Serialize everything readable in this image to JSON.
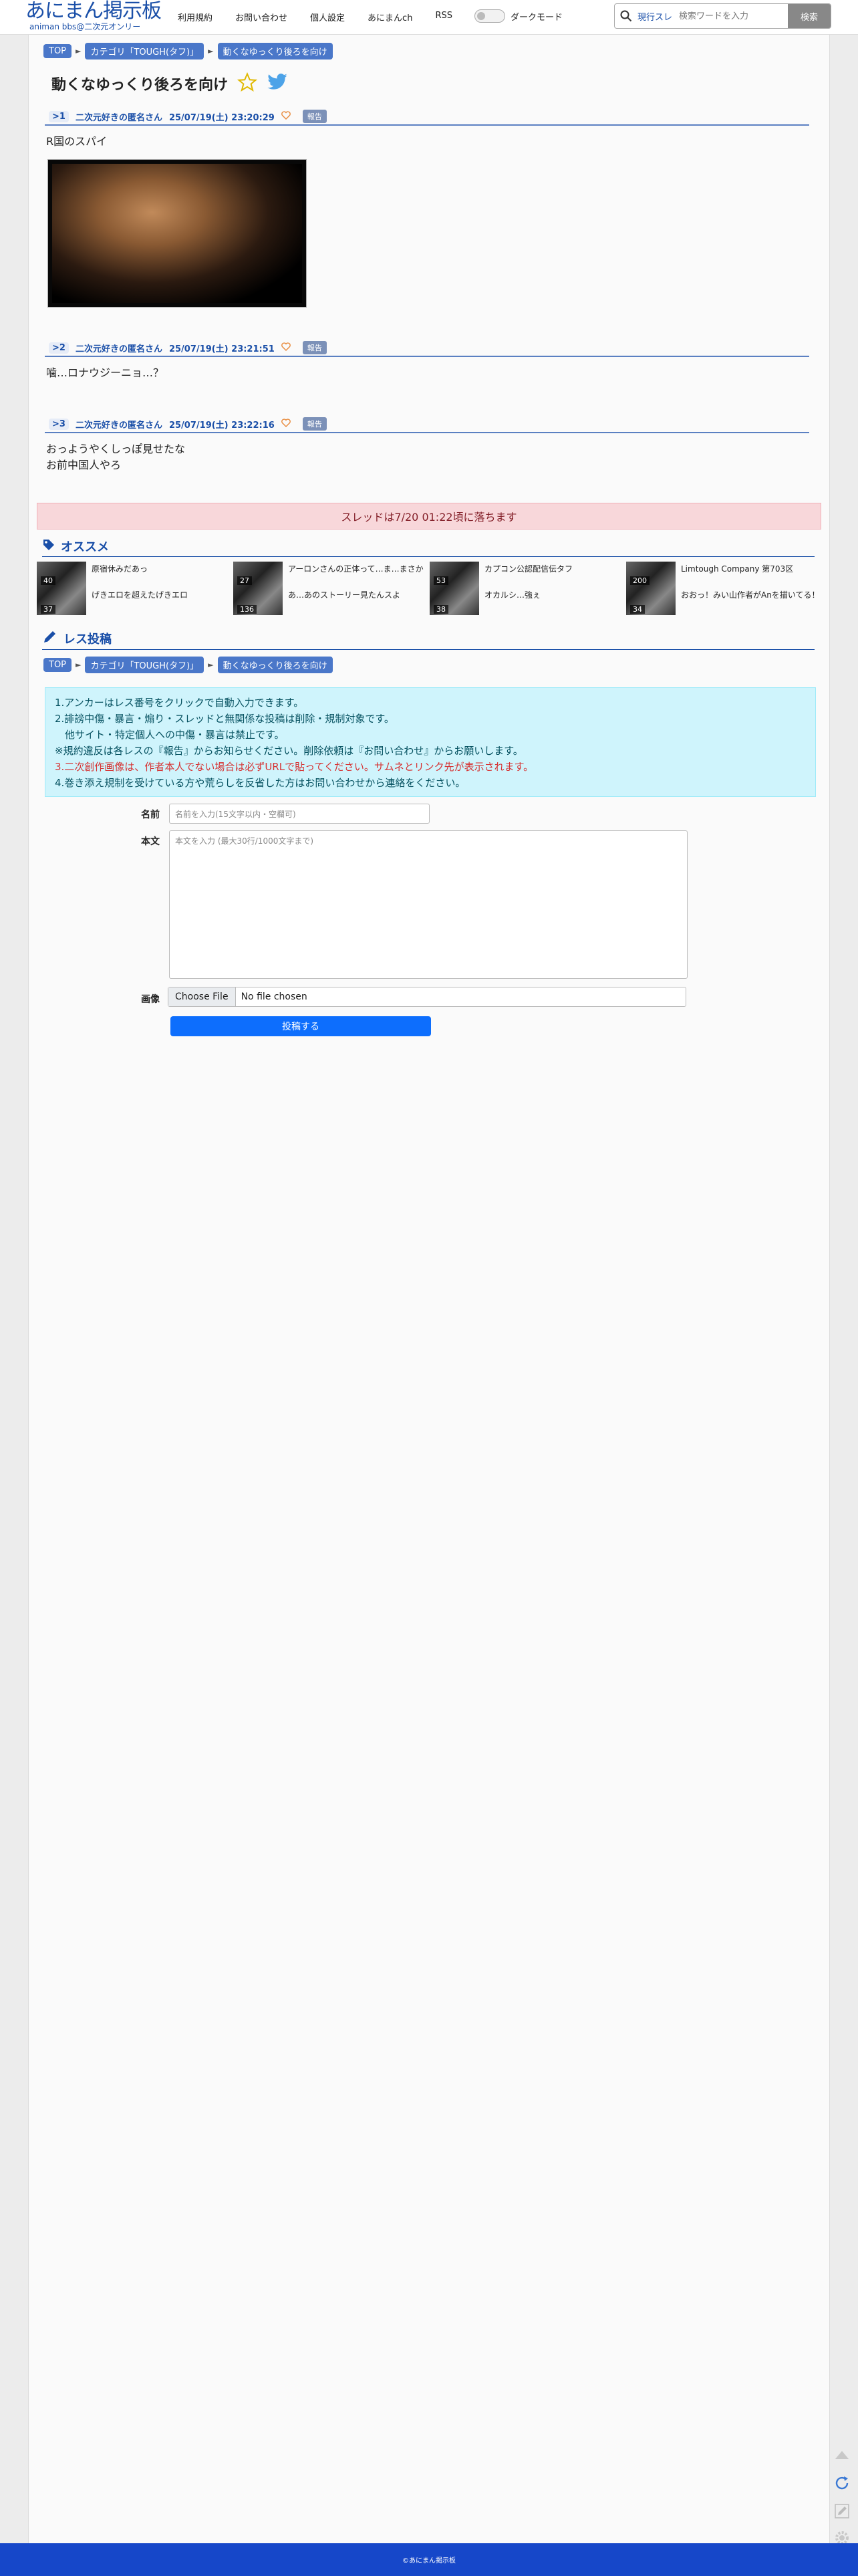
{
  "header": {
    "logo_main": "あにまん掲示板",
    "logo_sub": "animan bbs@二次元オンリー",
    "nav": [
      "利用規約",
      "お問い合わせ",
      "個人設定",
      "あにまんch",
      "RSS"
    ],
    "dark_mode_label": "ダークモード",
    "search_mode": "現行スレ",
    "search_placeholder": "検索ワードを入力",
    "search_button": "検索"
  },
  "breadcrumb": [
    "TOP",
    "カテゴリ「TOUGH(タフ)」",
    "動くなゆっくり後ろを向け"
  ],
  "thread": {
    "title": "動くなゆっくり後ろを向け",
    "posts": [
      {
        "no": ">1",
        "name": "二次元好きの匿名さん",
        "date": "25/07/19(土) 23:20:29",
        "report": "報告",
        "text": "R国のスパイ"
      },
      {
        "no": ">2",
        "name": "二次元好きの匿名さん",
        "date": "25/07/19(土) 23:21:51",
        "report": "報告",
        "text": "噛…ロナウジーニョ…？"
      },
      {
        "no": ">3",
        "name": "二次元好きの匿名さん",
        "date": "25/07/19(土) 23:22:16",
        "report": "報告",
        "text_lines": [
          "おっようやくしっぽ見せたな",
          "お前中国人やろ"
        ]
      }
    ],
    "notice": "スレッドは7/20 01:22頃に落ちます"
  },
  "recommend": {
    "heading": "オススメ",
    "items": [
      {
        "count_top": "40",
        "count_bottom": "37",
        "title1": "原宿休みだあっ",
        "title2": "げきエロを超えたげきエロ"
      },
      {
        "count_top": "27",
        "count_bottom": "136",
        "title1": "アーロンさんの正体って…ま…まさか",
        "title2": "あ…あのストーリー見たんスよ"
      },
      {
        "count_top": "53",
        "count_bottom": "38",
        "title1": "カプコン公認配信伝タフ",
        "title2": "オカルシ…強ぇ"
      },
      {
        "count_top": "200",
        "count_bottom": "34",
        "title1": "Limtough Company 第703区",
        "title2": "おおっ！みい山作者がAnを描いてる！"
      }
    ]
  },
  "post_form": {
    "heading": "レス投稿",
    "rules": [
      "1.アンカーはレス番号をクリックで自動入力できます。",
      "2.誹謗中傷・暴言・煽り・スレッドと無関係な投稿は削除・規制対象です。",
      "　他サイト・特定個人への中傷・暴言は禁止です。",
      "※規約違反は各レスの『報告』からお知らせください。削除依頼は『お問い合わせ』からお願いします。",
      "3.二次創作画像は、作者本人でない場合は必ずURLで貼ってください。サムネとリンク先が表示されます。",
      "4.巻き添え規制を受けている方や荒らしを反省した方はお問い合わせから連絡をください。"
    ],
    "name_label": "名前",
    "name_placeholder": "名前を入力(15文字以内・空欄可)",
    "body_label": "本文",
    "body_placeholder": "本文を入力 (最大30行/1000文字まで)",
    "image_label": "画像",
    "file_button": "Choose File",
    "file_status": "No file chosen",
    "submit": "投稿する"
  },
  "footer": "©あにまん掲示板",
  "colors": {
    "brand": "#1a4fa8",
    "footer": "#1647c9",
    "notice_bg": "#f8d7da",
    "rules_bg": "#cff4fc",
    "submit": "#0d6efd"
  }
}
